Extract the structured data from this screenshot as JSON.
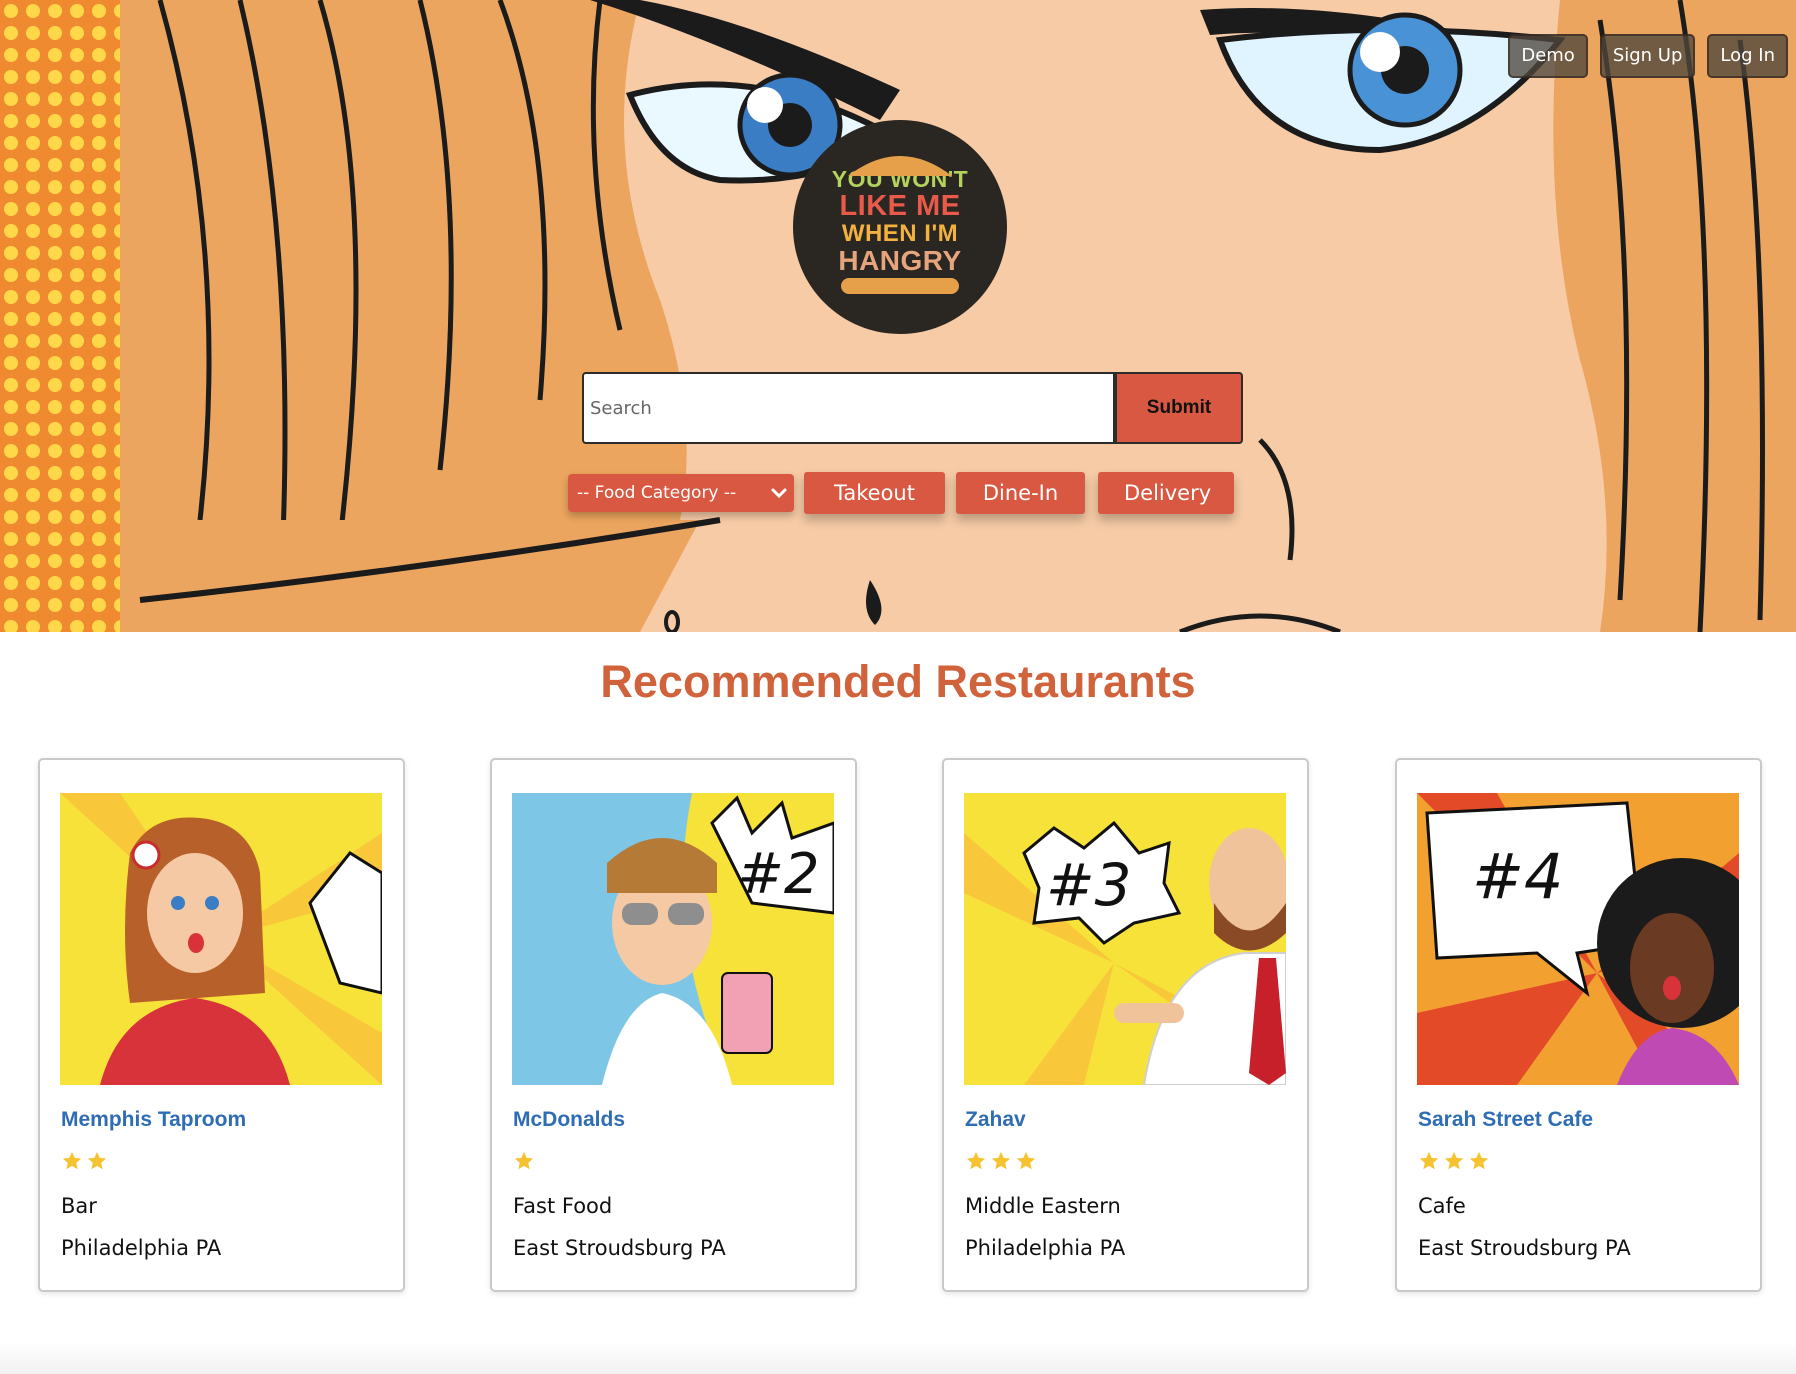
{
  "nav": {
    "demo": "Demo",
    "signup": "Sign Up",
    "login": "Log In"
  },
  "logo": {
    "line1": "YOU WON'T",
    "line2": "LIKE ME",
    "line3": "WHEN I'M",
    "line4": "HANGRY"
  },
  "search": {
    "placeholder": "Search",
    "value": "",
    "submit": "Submit"
  },
  "filters": {
    "category": "-- Food Category --",
    "takeout": "Takeout",
    "dinein": "Dine-In",
    "delivery": "Delivery"
  },
  "section": {
    "title": "Recommended Restaurants"
  },
  "restaurants": [
    {
      "name": "Memphis Taproom",
      "stars": 2,
      "category": "Bar",
      "location": "Philadelphia PA",
      "badge": "#"
    },
    {
      "name": "McDonalds",
      "stars": 1,
      "category": "Fast Food",
      "location": "East Stroudsburg PA",
      "badge": "#2"
    },
    {
      "name": "Zahav",
      "stars": 3,
      "category": "Middle Eastern",
      "location": "Philadelphia PA",
      "badge": "#3"
    },
    {
      "name": "Sarah Street Cafe",
      "stars": 3,
      "category": "Cafe",
      "location": "East Stroudsburg PA",
      "badge": "#4"
    }
  ],
  "colors": {
    "accent": "#d95842",
    "title": "#d0633c",
    "link": "#2e6db4",
    "star": "#f5c230"
  }
}
